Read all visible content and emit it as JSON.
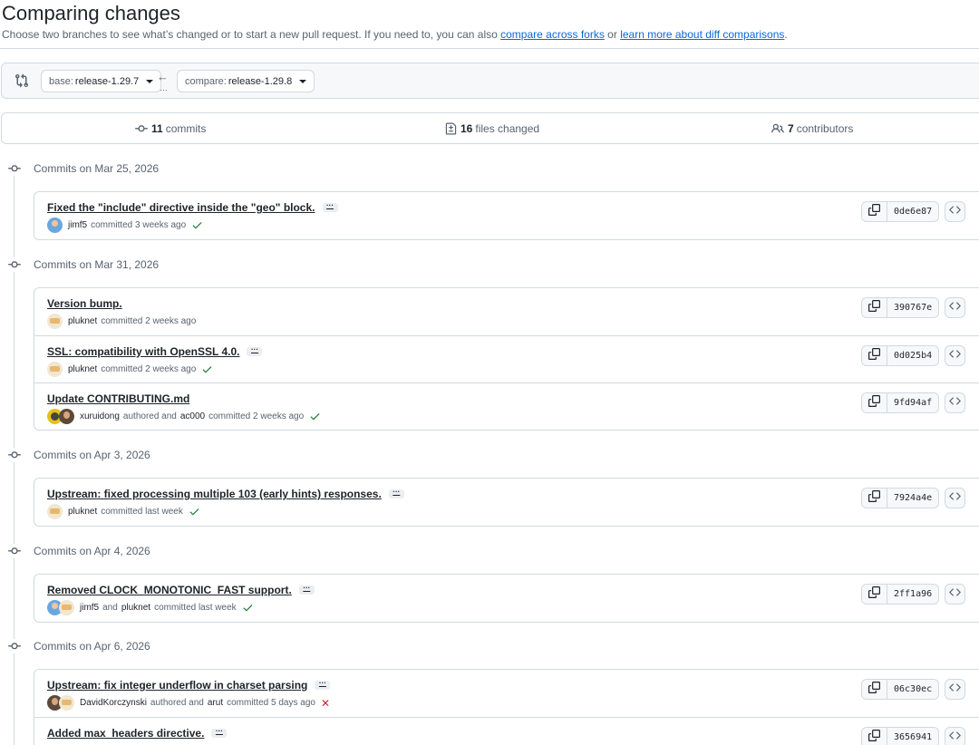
{
  "header": {
    "title": "Comparing changes",
    "subtitle_prefix": "Choose two branches to see what’s changed or to start a new pull request. If you need to, you can also",
    "link_compare_forks": "compare across forks",
    "subtitle_or": "or",
    "link_learn_more": "learn more about diff comparisons",
    "subtitle_end": "."
  },
  "range": {
    "base_label": "base:",
    "base_value": "release-1.29.7",
    "compare_label": "compare:",
    "compare_value": "release-1.29.8",
    "arrow": "←",
    "dots": "…"
  },
  "summary": {
    "commits_count": "11",
    "commits_label": "commits",
    "files_count": "16",
    "files_label": "files changed",
    "contributors_count": "7",
    "contributors_label": "contributors"
  },
  "groups": [
    {
      "heading": "Commits on Mar 25, 2026",
      "commits": [
        {
          "title": "Fixed the \"include\" directive inside the \"geo\" block.",
          "more": "···",
          "avatar": "blue",
          "meta": [
            {
              "user": "jimf5"
            },
            {
              "text": "committed 3 weeks ago"
            }
          ],
          "status": "success",
          "sha": "0de6e87"
        }
      ]
    },
    {
      "heading": "Commits on Mar 31, 2026",
      "commits": [
        {
          "title": "Version bump.",
          "more": "",
          "avatar": "tan",
          "meta": [
            {
              "user": "pluknet"
            },
            {
              "text": "committed 2 weeks ago"
            }
          ],
          "status": "",
          "sha": "390767e"
        },
        {
          "title": "SSL: compatibility with OpenSSL 4.0.",
          "more": "···",
          "avatar": "tan",
          "meta": [
            {
              "user": "pluknet"
            },
            {
              "text": "committed 2 weeks ago"
            }
          ],
          "status": "success",
          "sha": "0d025b4"
        },
        {
          "title": "Update CONTRIBUTING.md",
          "more": "",
          "avatar": "yellow-pair",
          "meta": [
            {
              "user": "xuruidong"
            },
            {
              "text": "authored and"
            },
            {
              "user": "ac000"
            },
            {
              "text": "committed 2 weeks ago"
            }
          ],
          "status": "success",
          "sha": "9fd94af"
        }
      ]
    },
    {
      "heading": "Commits on Apr 3, 2026",
      "commits": [
        {
          "title": "Upstream: fixed processing multiple 103 (early hints) responses.",
          "more": "···",
          "avatar": "tan",
          "meta": [
            {
              "user": "pluknet"
            },
            {
              "text": "committed last week"
            }
          ],
          "status": "success",
          "sha": "7924a4e"
        }
      ]
    },
    {
      "heading": "Commits on Apr 4, 2026",
      "commits": [
        {
          "title": "Removed CLOCK_MONOTONIC_FAST support.",
          "more": "···",
          "avatar": "blue-pair",
          "meta": [
            {
              "user": "jimf5"
            },
            {
              "text": "and"
            },
            {
              "user": "pluknet"
            },
            {
              "text": "committed last week"
            }
          ],
          "status": "success",
          "sha": "2ff1a96"
        }
      ]
    },
    {
      "heading": "Commits on Apr 6, 2026",
      "commits": [
        {
          "title": "Upstream: fix integer underflow in charset parsing",
          "more": "···",
          "avatar": "dark-pair",
          "meta": [
            {
              "user": "DavidKorczynski"
            },
            {
              "text": "authored and"
            },
            {
              "user": "arut"
            },
            {
              "text": "committed 5 days ago"
            }
          ],
          "status": "failure",
          "sha": "06c30ec"
        },
        {
          "title": "Added max_headers directive.",
          "more": "···",
          "avatar": "dark",
          "meta": [],
          "status": "",
          "sha": "3656941"
        }
      ]
    }
  ],
  "icons": {
    "copy": "copy-icon",
    "code": "code-icon",
    "commit": "git-commit-icon",
    "compare": "git-compare-icon",
    "files": "file-diff-icon",
    "people": "people-icon",
    "check": "check-icon",
    "cross": "x-icon"
  },
  "colors": {
    "link": "#0969da",
    "success": "#1a7f37",
    "failure": "#d1242f",
    "border": "#d1d9e0"
  }
}
